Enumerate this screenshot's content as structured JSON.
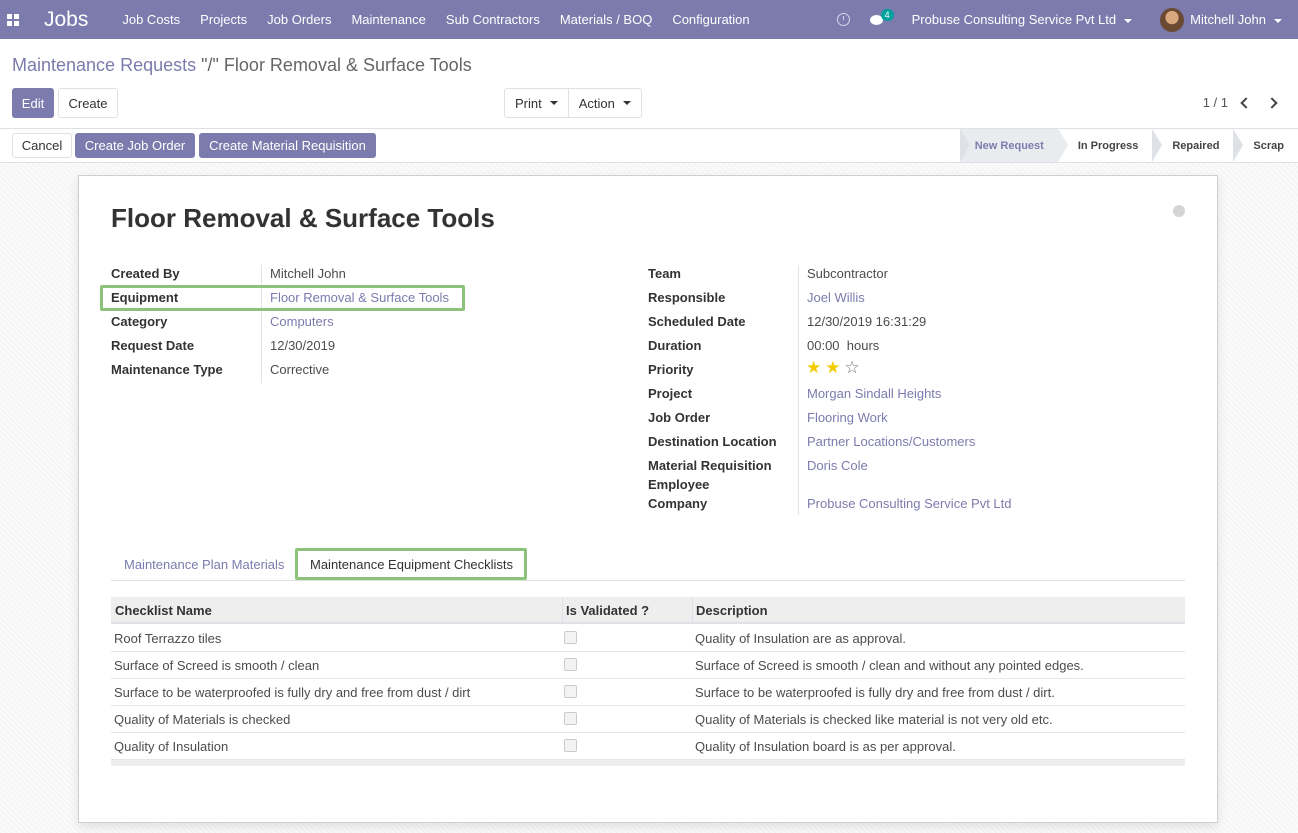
{
  "navbar": {
    "brand": "Jobs",
    "menu": [
      "Job Costs",
      "Projects",
      "Job Orders",
      "Maintenance",
      "Sub Contractors",
      "Materials / BOQ",
      "Configuration"
    ],
    "chat_count": "4",
    "company": "Probuse Consulting Service Pvt Ltd",
    "user": "Mitchell John",
    "color": "#7c7bad"
  },
  "breadcrumb": {
    "parent": "Maintenance Requests",
    "separator": " \"/\" ",
    "current": "Floor Removal & Surface Tools"
  },
  "buttons": {
    "edit": "Edit",
    "create": "Create",
    "print": "Print",
    "action": "Action",
    "cancel": "Cancel",
    "create_job_order": "Create Job Order",
    "create_material_requisition": "Create Material Requisition"
  },
  "pager": {
    "value": "1 / 1"
  },
  "stages": [
    "New Request",
    "In Progress",
    "Repaired",
    "Scrap"
  ],
  "form": {
    "title": "Floor Removal & Surface Tools",
    "left": [
      {
        "label": "Created By",
        "value": "Mitchell John"
      },
      {
        "label": "Equipment",
        "value": "Floor Removal & Surface Tools"
      },
      {
        "label": "Category",
        "value": "Computers"
      },
      {
        "label": "Request Date",
        "value": "12/30/2019"
      },
      {
        "label": "Maintenance Type",
        "value": "Corrective"
      }
    ],
    "right": [
      {
        "label": "Team",
        "value": "Subcontractor"
      },
      {
        "label": "Responsible",
        "value": "Joel Willis"
      },
      {
        "label": "Scheduled Date",
        "value": "12/30/2019 16:31:29"
      },
      {
        "label": "Duration",
        "value": "00:00  hours"
      },
      {
        "label": "Priority",
        "value": ""
      },
      {
        "label": "Project",
        "value": "Morgan Sindall Heights"
      },
      {
        "label": "Job Order",
        "value": "Flooring Work"
      },
      {
        "label": "Destination Location",
        "value": "Partner Locations/Customers"
      },
      {
        "label": "Material Requisition",
        "value": "Doris Cole"
      },
      {
        "label": "Employee",
        "value": ""
      },
      {
        "label": "Company",
        "value": "Probuse Consulting Service Pvt Ltd"
      }
    ],
    "priority_stars": 2,
    "priority_max": 3
  },
  "tabs": [
    "Maintenance Plan Materials",
    "Maintenance Equipment Checklists"
  ],
  "table": {
    "headers": [
      "Checklist Name",
      "Is Validated ?",
      "Description"
    ],
    "rows": [
      {
        "name": "Roof Terrazzo tiles",
        "validated": false,
        "description": "Quality of Insulation are as approval."
      },
      {
        "name": "Surface of Screed is smooth / clean",
        "validated": false,
        "description": "Surface of Screed is smooth / clean and without any pointed edges."
      },
      {
        "name": "Surface to be waterproofed is fully dry and free from dust / dirt",
        "validated": false,
        "description": "Surface to be waterproofed is fully dry and free from dust / dirt."
      },
      {
        "name": "Quality of Materials is checked",
        "validated": false,
        "description": "Quality of Materials is checked like material is not very old etc."
      },
      {
        "name": "Quality of Insulation",
        "validated": false,
        "description": "Quality of Insulation board is as per approval."
      }
    ]
  }
}
